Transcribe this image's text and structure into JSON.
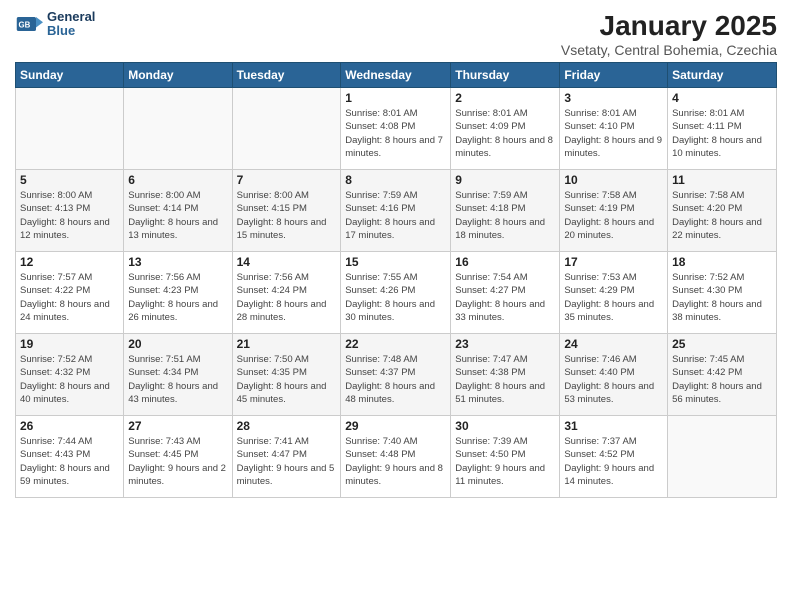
{
  "header": {
    "logo_line1": "General",
    "logo_line2": "Blue",
    "month_year": "January 2025",
    "location": "Vsetaty, Central Bohemia, Czechia"
  },
  "days_of_week": [
    "Sunday",
    "Monday",
    "Tuesday",
    "Wednesday",
    "Thursday",
    "Friday",
    "Saturday"
  ],
  "weeks": [
    [
      {
        "day": "",
        "info": ""
      },
      {
        "day": "",
        "info": ""
      },
      {
        "day": "",
        "info": ""
      },
      {
        "day": "1",
        "info": "Sunrise: 8:01 AM\nSunset: 4:08 PM\nDaylight: 8 hours and 7 minutes."
      },
      {
        "day": "2",
        "info": "Sunrise: 8:01 AM\nSunset: 4:09 PM\nDaylight: 8 hours and 8 minutes."
      },
      {
        "day": "3",
        "info": "Sunrise: 8:01 AM\nSunset: 4:10 PM\nDaylight: 8 hours and 9 minutes."
      },
      {
        "day": "4",
        "info": "Sunrise: 8:01 AM\nSunset: 4:11 PM\nDaylight: 8 hours and 10 minutes."
      }
    ],
    [
      {
        "day": "5",
        "info": "Sunrise: 8:00 AM\nSunset: 4:13 PM\nDaylight: 8 hours and 12 minutes."
      },
      {
        "day": "6",
        "info": "Sunrise: 8:00 AM\nSunset: 4:14 PM\nDaylight: 8 hours and 13 minutes."
      },
      {
        "day": "7",
        "info": "Sunrise: 8:00 AM\nSunset: 4:15 PM\nDaylight: 8 hours and 15 minutes."
      },
      {
        "day": "8",
        "info": "Sunrise: 7:59 AM\nSunset: 4:16 PM\nDaylight: 8 hours and 17 minutes."
      },
      {
        "day": "9",
        "info": "Sunrise: 7:59 AM\nSunset: 4:18 PM\nDaylight: 8 hours and 18 minutes."
      },
      {
        "day": "10",
        "info": "Sunrise: 7:58 AM\nSunset: 4:19 PM\nDaylight: 8 hours and 20 minutes."
      },
      {
        "day": "11",
        "info": "Sunrise: 7:58 AM\nSunset: 4:20 PM\nDaylight: 8 hours and 22 minutes."
      }
    ],
    [
      {
        "day": "12",
        "info": "Sunrise: 7:57 AM\nSunset: 4:22 PM\nDaylight: 8 hours and 24 minutes."
      },
      {
        "day": "13",
        "info": "Sunrise: 7:56 AM\nSunset: 4:23 PM\nDaylight: 8 hours and 26 minutes."
      },
      {
        "day": "14",
        "info": "Sunrise: 7:56 AM\nSunset: 4:24 PM\nDaylight: 8 hours and 28 minutes."
      },
      {
        "day": "15",
        "info": "Sunrise: 7:55 AM\nSunset: 4:26 PM\nDaylight: 8 hours and 30 minutes."
      },
      {
        "day": "16",
        "info": "Sunrise: 7:54 AM\nSunset: 4:27 PM\nDaylight: 8 hours and 33 minutes."
      },
      {
        "day": "17",
        "info": "Sunrise: 7:53 AM\nSunset: 4:29 PM\nDaylight: 8 hours and 35 minutes."
      },
      {
        "day": "18",
        "info": "Sunrise: 7:52 AM\nSunset: 4:30 PM\nDaylight: 8 hours and 38 minutes."
      }
    ],
    [
      {
        "day": "19",
        "info": "Sunrise: 7:52 AM\nSunset: 4:32 PM\nDaylight: 8 hours and 40 minutes."
      },
      {
        "day": "20",
        "info": "Sunrise: 7:51 AM\nSunset: 4:34 PM\nDaylight: 8 hours and 43 minutes."
      },
      {
        "day": "21",
        "info": "Sunrise: 7:50 AM\nSunset: 4:35 PM\nDaylight: 8 hours and 45 minutes."
      },
      {
        "day": "22",
        "info": "Sunrise: 7:48 AM\nSunset: 4:37 PM\nDaylight: 8 hours and 48 minutes."
      },
      {
        "day": "23",
        "info": "Sunrise: 7:47 AM\nSunset: 4:38 PM\nDaylight: 8 hours and 51 minutes."
      },
      {
        "day": "24",
        "info": "Sunrise: 7:46 AM\nSunset: 4:40 PM\nDaylight: 8 hours and 53 minutes."
      },
      {
        "day": "25",
        "info": "Sunrise: 7:45 AM\nSunset: 4:42 PM\nDaylight: 8 hours and 56 minutes."
      }
    ],
    [
      {
        "day": "26",
        "info": "Sunrise: 7:44 AM\nSunset: 4:43 PM\nDaylight: 8 hours and 59 minutes."
      },
      {
        "day": "27",
        "info": "Sunrise: 7:43 AM\nSunset: 4:45 PM\nDaylight: 9 hours and 2 minutes."
      },
      {
        "day": "28",
        "info": "Sunrise: 7:41 AM\nSunset: 4:47 PM\nDaylight: 9 hours and 5 minutes."
      },
      {
        "day": "29",
        "info": "Sunrise: 7:40 AM\nSunset: 4:48 PM\nDaylight: 9 hours and 8 minutes."
      },
      {
        "day": "30",
        "info": "Sunrise: 7:39 AM\nSunset: 4:50 PM\nDaylight: 9 hours and 11 minutes."
      },
      {
        "day": "31",
        "info": "Sunrise: 7:37 AM\nSunset: 4:52 PM\nDaylight: 9 hours and 14 minutes."
      },
      {
        "day": "",
        "info": ""
      }
    ]
  ]
}
